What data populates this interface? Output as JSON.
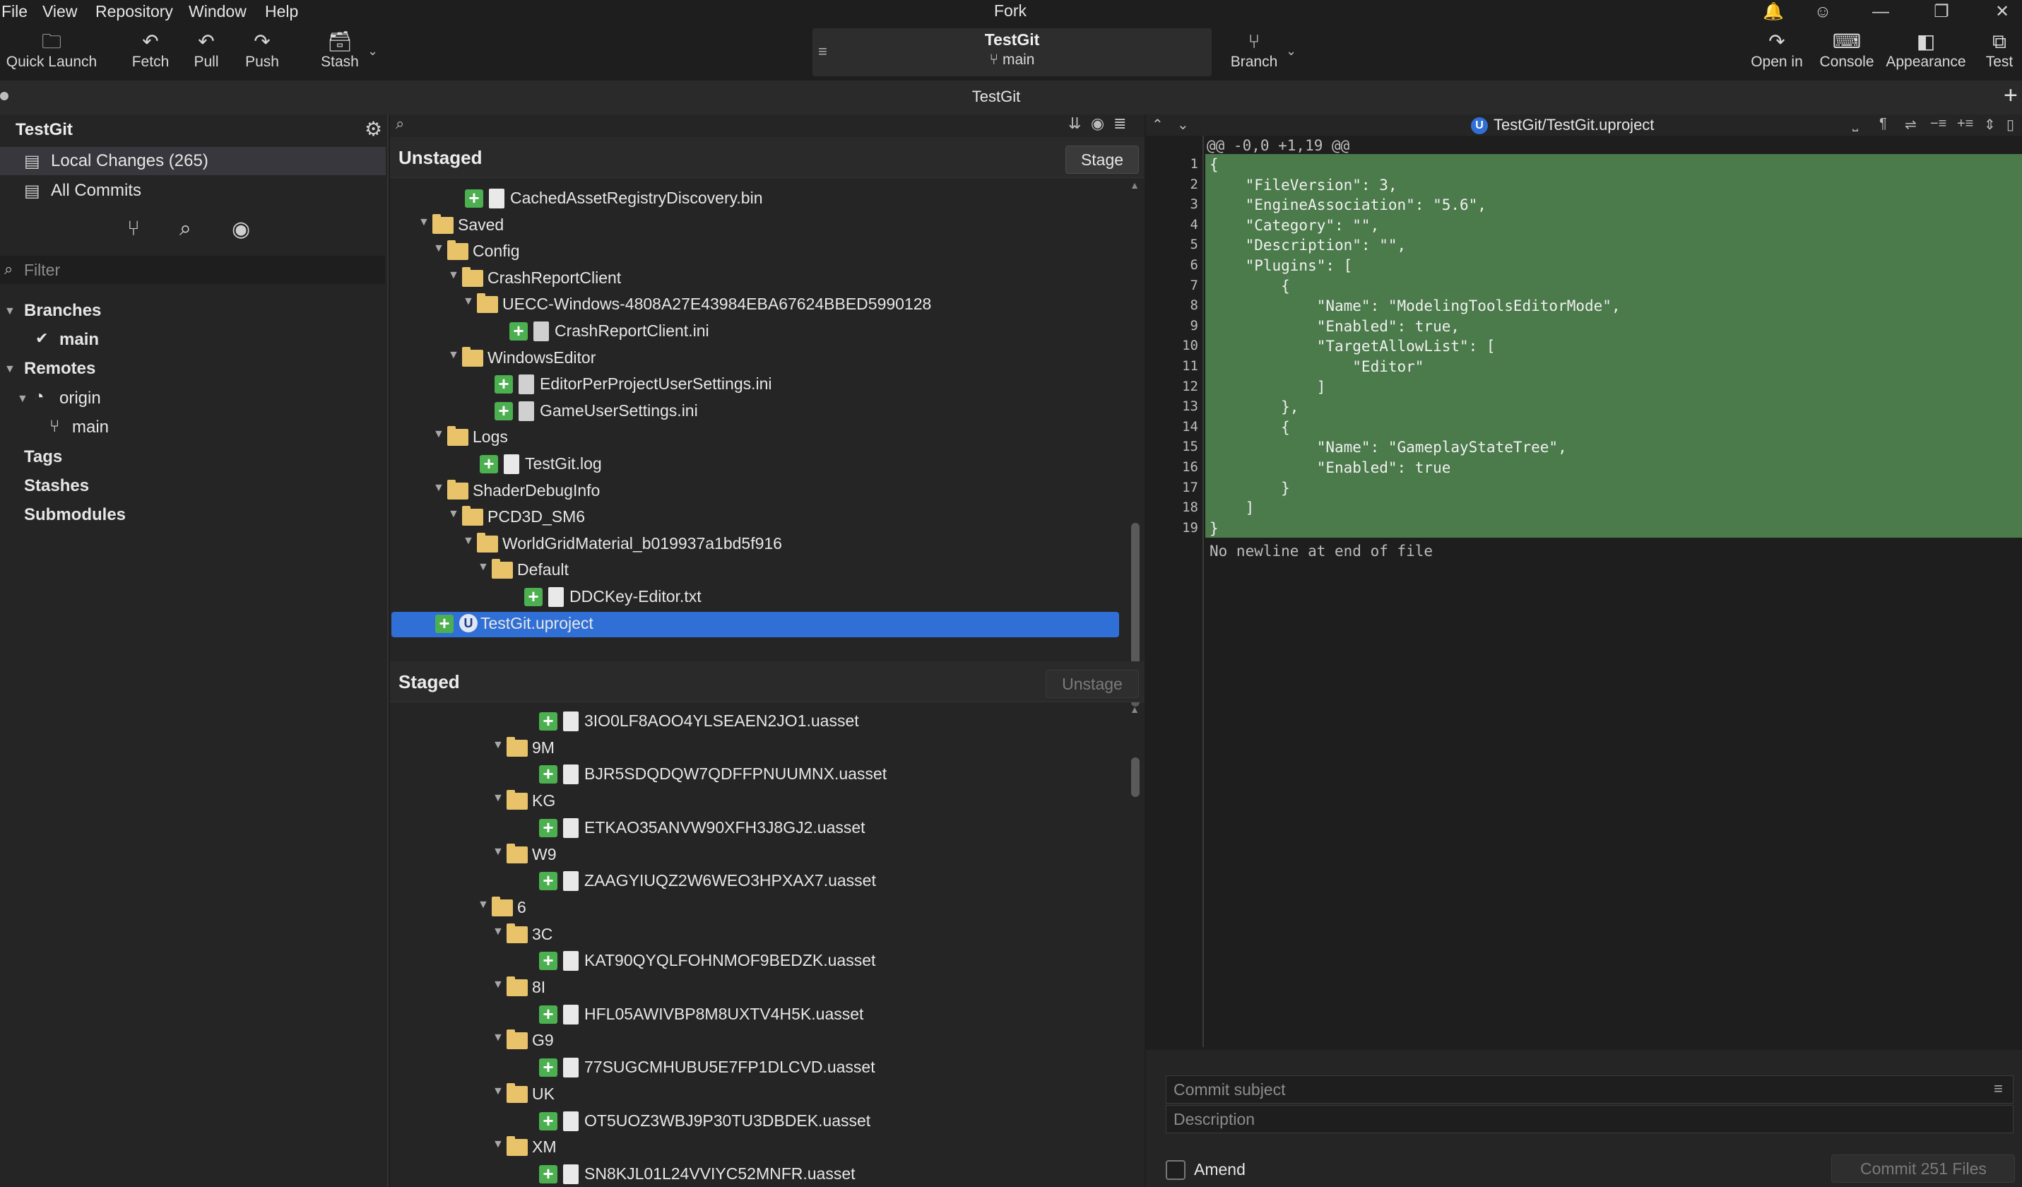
{
  "menubar": {
    "items": [
      "File",
      "View",
      "Repository",
      "Window",
      "Help"
    ],
    "app_title": "Fork"
  },
  "toolbar": {
    "quick_launch": "Quick Launch",
    "fetch": "Fetch",
    "pull": "Pull",
    "push": "Push",
    "stash": "Stash",
    "repo_name": "TestGit",
    "repo_branch": "main",
    "branch": "Branch",
    "open_in": "Open in",
    "console": "Console",
    "appearance": "Appearance",
    "test": "Test"
  },
  "tab": {
    "title": "TestGit"
  },
  "sidebar": {
    "repo": "TestGit",
    "local_changes": "Local Changes (265)",
    "all_commits": "All Commits",
    "filter_placeholder": "Filter",
    "branches": "Branches",
    "branch_main": "main",
    "remotes": "Remotes",
    "origin": "origin",
    "origin_main": "main",
    "tags": "Tags",
    "stashes": "Stashes",
    "submodules": "Submodules"
  },
  "unstaged": {
    "title": "Unstaged",
    "button": "Stage",
    "rows": [
      {
        "name": "CachedAssetRegistryDiscovery.bin",
        "depth": 4,
        "kind": "file",
        "added": true
      },
      {
        "name": "Saved",
        "depth": 2,
        "kind": "folder",
        "added": false
      },
      {
        "name": "Config",
        "depth": 3,
        "kind": "folder",
        "added": false
      },
      {
        "name": "CrashReportClient",
        "depth": 4,
        "kind": "folder",
        "added": false
      },
      {
        "name": "UECC-Windows-4808A27E43984EBA67624BBED5990128",
        "depth": 5,
        "kind": "folder",
        "added": false
      },
      {
        "name": "CrashReportClient.ini",
        "depth": 7,
        "kind": "config",
        "added": true
      },
      {
        "name": "WindowsEditor",
        "depth": 4,
        "kind": "folder",
        "added": false
      },
      {
        "name": "EditorPerProjectUserSettings.ini",
        "depth": 6,
        "kind": "config",
        "added": true
      },
      {
        "name": "GameUserSettings.ini",
        "depth": 6,
        "kind": "config",
        "added": true
      },
      {
        "name": "Logs",
        "depth": 3,
        "kind": "folder",
        "added": false
      },
      {
        "name": "TestGit.log",
        "depth": 5,
        "kind": "file",
        "added": true
      },
      {
        "name": "ShaderDebugInfo",
        "depth": 3,
        "kind": "folder",
        "added": false
      },
      {
        "name": "PCD3D_SM6",
        "depth": 4,
        "kind": "folder",
        "added": false
      },
      {
        "name": "WorldGridMaterial_b019937a1bd5f916",
        "depth": 5,
        "kind": "folder",
        "added": false
      },
      {
        "name": "Default",
        "depth": 6,
        "kind": "folder",
        "added": false
      },
      {
        "name": "DDCKey-Editor.txt",
        "depth": 8,
        "kind": "file",
        "added": true
      },
      {
        "name": "TestGit.uproject",
        "depth": 2,
        "kind": "uproject",
        "added": true,
        "selected": true
      }
    ]
  },
  "staged": {
    "title": "Staged",
    "button": "Unstage",
    "rows": [
      {
        "name": "3IO0LF8AOO4YLSEAEN2JO1.uasset",
        "depth": 9,
        "kind": "file",
        "added": true
      },
      {
        "name": "9M",
        "depth": 7,
        "kind": "folder",
        "added": false
      },
      {
        "name": "BJR5SDQDQW7QDFFPNUUMNX.uasset",
        "depth": 9,
        "kind": "file",
        "added": true
      },
      {
        "name": "KG",
        "depth": 7,
        "kind": "folder",
        "added": false
      },
      {
        "name": "ETKAO35ANVW90XFH3J8GJ2.uasset",
        "depth": 9,
        "kind": "file",
        "added": true
      },
      {
        "name": "W9",
        "depth": 7,
        "kind": "folder",
        "added": false
      },
      {
        "name": "ZAAGYIUQZ2W6WEO3HPXAX7.uasset",
        "depth": 9,
        "kind": "file",
        "added": true
      },
      {
        "name": "6",
        "depth": 6,
        "kind": "folder",
        "added": false
      },
      {
        "name": "3C",
        "depth": 7,
        "kind": "folder",
        "added": false
      },
      {
        "name": "KAT90QYQLFOHNMOF9BEDZK.uasset",
        "depth": 9,
        "kind": "file",
        "added": true
      },
      {
        "name": "8I",
        "depth": 7,
        "kind": "folder",
        "added": false
      },
      {
        "name": "HFL05AWIVBP8M8UXTV4H5K.uasset",
        "depth": 9,
        "kind": "file",
        "added": true
      },
      {
        "name": "G9",
        "depth": 7,
        "kind": "folder",
        "added": false
      },
      {
        "name": "77SUGCMHUBU5E7FP1DLCVD.uasset",
        "depth": 9,
        "kind": "file",
        "added": true
      },
      {
        "name": "UK",
        "depth": 7,
        "kind": "folder",
        "added": false
      },
      {
        "name": "OT5UOZ3WBJ9P30TU3DBDEK.uasset",
        "depth": 9,
        "kind": "file",
        "added": true
      },
      {
        "name": "XM",
        "depth": 7,
        "kind": "folder",
        "added": false
      },
      {
        "name": "SN8KJL01L24VVIYC52MNFR.uasset",
        "depth": 9,
        "kind": "file",
        "added": true
      }
    ]
  },
  "diff": {
    "file": "TestGit/TestGit.uproject",
    "hunk": "@@ -0,0 +1,19 @@",
    "lines": [
      "{",
      "    \"FileVersion\": 3,",
      "    \"EngineAssociation\": \"5.6\",",
      "    \"Category\": \"\",",
      "    \"Description\": \"\",",
      "    \"Plugins\": [",
      "        {",
      "            \"Name\": \"ModelingToolsEditorMode\",",
      "            \"Enabled\": true,",
      "            \"TargetAllowList\": [",
      "                \"Editor\"",
      "            ]",
      "        },",
      "        {",
      "            \"Name\": \"GameplayStateTree\",",
      "            \"Enabled\": true",
      "        }",
      "    ]",
      "}"
    ],
    "no_newline": "No newline at end of file"
  },
  "commit": {
    "subject_placeholder": "Commit subject",
    "description_placeholder": "Description",
    "amend": "Amend",
    "button": "Commit 251 Files"
  }
}
